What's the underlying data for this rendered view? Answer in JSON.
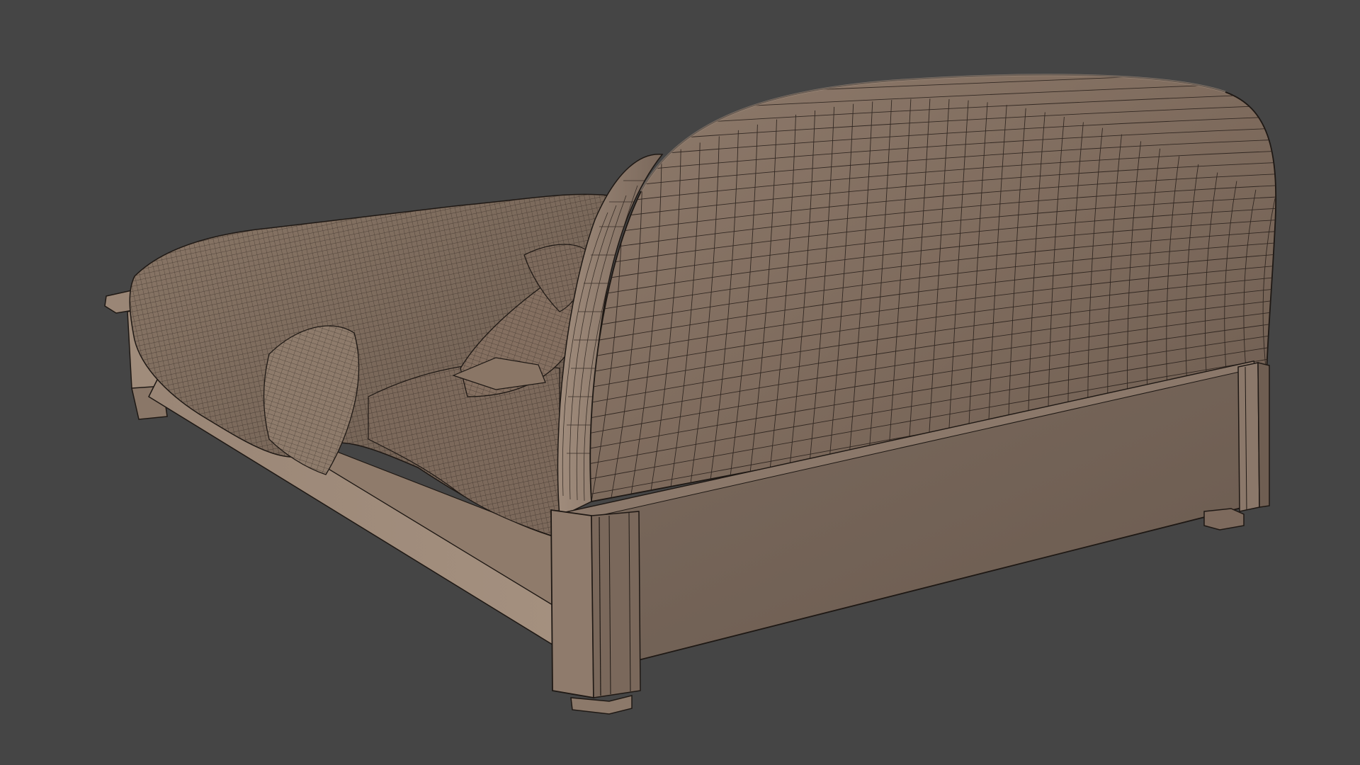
{
  "viewport": {
    "background_color": "#454545",
    "shading_mode": "wireframe-over-shaded",
    "object": "bed-model"
  },
  "colors": {
    "surface_light": "#9c8878",
    "surface_mid": "#7e6b5d",
    "surface_dark": "#5e4f45",
    "wire": "#2a211c"
  }
}
